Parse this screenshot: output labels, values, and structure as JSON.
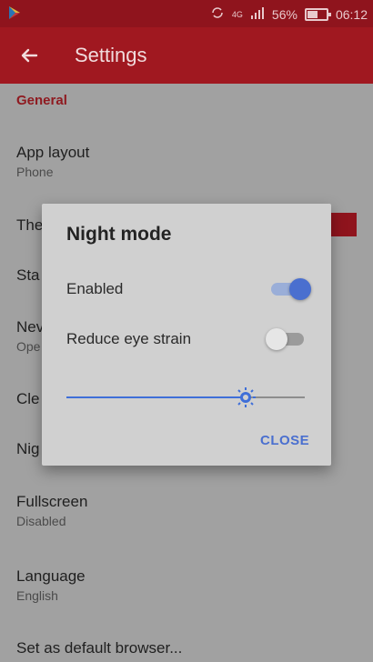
{
  "status_bar": {
    "battery": "56%",
    "time": "06:12",
    "network": "4G"
  },
  "app_bar": {
    "title": "Settings"
  },
  "settings": {
    "section_general": "General",
    "items": [
      {
        "title": "App layout",
        "value": "Phone"
      },
      {
        "title": "The"
      },
      {
        "title": "Sta"
      },
      {
        "title": "Nev",
        "value": "Ope"
      },
      {
        "title": "Cle"
      },
      {
        "title": "Nig"
      },
      {
        "title": "Fullscreen",
        "value": "Disabled"
      },
      {
        "title": "Language",
        "value": "English"
      },
      {
        "title": "Set as default browser..."
      }
    ]
  },
  "dialog": {
    "title": "Night mode",
    "enabled_label": "Enabled",
    "reduce_eye_strain_label": "Reduce eye strain",
    "enabled": true,
    "reduce_eye_strain": false,
    "brightness_level": 0.75,
    "close_label": "CLOSE"
  },
  "colors": {
    "primary": "#d32f2f",
    "accent": "#3f6fd8"
  }
}
